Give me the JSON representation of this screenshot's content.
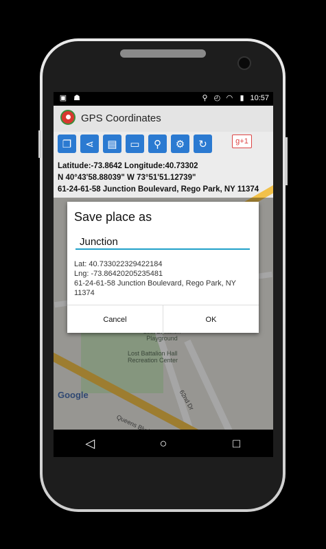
{
  "statusbar": {
    "time": "10:57",
    "left_icons": [
      "image-icon",
      "android-icon"
    ],
    "right_icons": [
      "location-pin-icon",
      "alarm-icon",
      "wifi-icon",
      "battery-icon"
    ]
  },
  "app": {
    "title": "GPS Coordinates",
    "toolbar": [
      "copy-icon",
      "share-icon",
      "save-icon",
      "folder-icon",
      "search-icon",
      "settings-icon",
      "refresh-icon"
    ],
    "gplus_label": "g+1",
    "coords_line1": "Latitude:-73.8642 Longitude:40.73302",
    "coords_line2": "N 40°43'58.88039\" W 73°51'51.12739\"",
    "coords_line3": "61-24-61-58 Junction Boulevard, Rego Park, NY 11374"
  },
  "map": {
    "labels": [
      "Lost Battalion Playground",
      "Lost Battalion Hall Recreation Center",
      "Queens Blvd",
      "62nd Dr",
      "Google"
    ]
  },
  "dialog": {
    "title": "Save place as",
    "input_value": "Junction",
    "lat": "Lat: 40.733022329422184",
    "lng": "Lng: -73.86420205235481",
    "address": "61-24-61-58 Junction Boulevard, Rego Park, NY 11374",
    "cancel": "Cancel",
    "ok": "OK"
  },
  "navbar": {
    "icons": [
      "back-icon",
      "home-icon",
      "recents-icon"
    ]
  }
}
